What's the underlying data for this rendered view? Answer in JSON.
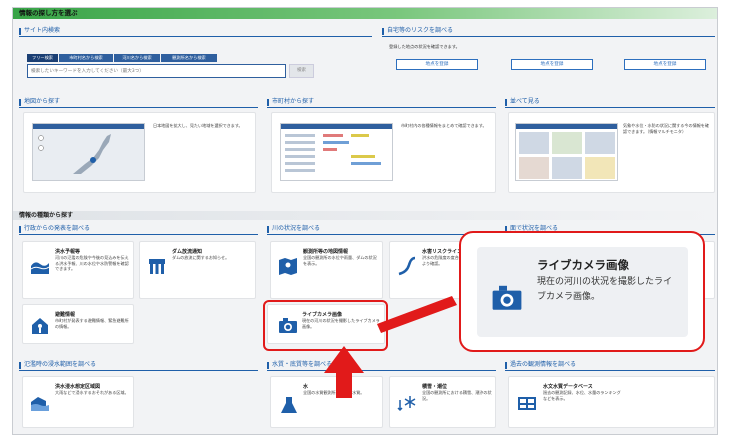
{
  "top_title": "情報の探し方を選ぶ",
  "site_search": {
    "title": "サイト内検索",
    "tabs": [
      "フリー検索",
      "市町村名から検索",
      "河川名から検索",
      "観測所名から検索"
    ],
    "placeholder": "検索したいキーワードを入力してください（最大3つ）",
    "button": "検索"
  },
  "risk": {
    "title": "自宅等のリスクを調べる",
    "desc": "登録した地点の状況を確認できます。",
    "buttons": [
      "地点を登録",
      "地点を登録",
      "地点を登録"
    ]
  },
  "map_search": {
    "title": "地図から探す",
    "desc": "日本地図を拡大し、見たい地域を選択できます。"
  },
  "city_search": {
    "title": "市町村から探す",
    "desc": "市町村内の各種情報をまとめて確認できます。"
  },
  "compare": {
    "title": "並べて見る",
    "desc": "気象や水位・水防の状況に関する今の情報を確認できます。（情報マルチモニタ）"
  },
  "kind_title": "情報の種類から探す",
  "gov": {
    "title": "行政からの発表を調べる",
    "items": [
      {
        "name": "洪水予報等",
        "desc": "河川の氾濫の危険や今後の見込みを伝える洪水予報、川の水位や水防警報を確認できます。"
      },
      {
        "name": "ダム放流通知",
        "desc": "ダムの放流に関するお知らせ。"
      },
      {
        "name": "避難情報",
        "desc": "市町村が発表する避難情報、緊急避難所の情報。"
      }
    ]
  },
  "river": {
    "title": "川の状況を調べる",
    "items": [
      {
        "name": "観測所等の地図情報",
        "desc": "全国の観測所の水位や雨量、ダムの状況を表示。"
      },
      {
        "name": "水害リスクライン",
        "desc": "洪水の危険度の度合いを地図上で線により確認。"
      },
      {
        "name": "ライブカメラ画像",
        "desc": "現在の河川の状況を撮影したライブカメラ画像。"
      }
    ]
  },
  "area": {
    "title": "面で状況を調べる"
  },
  "flood": {
    "title": "氾濫時の浸水範囲を調べる",
    "items": [
      {
        "name": "洪水浸水想定区域図",
        "desc": "大雨などで浸水するおそれがある区域。"
      }
    ]
  },
  "quality": {
    "title": "水質・底質等を調べる",
    "items": [
      {
        "name": "水",
        "desc": "全国の水質観測所における水質。"
      },
      {
        "name": "積雪・潮位",
        "desc": "全国の観測所における積雪、潮汐の状況。"
      }
    ]
  },
  "past": {
    "title": "過去の観測情報を調べる",
    "items": [
      {
        "name": "水文水質データベース",
        "desc": "過去の観測記録、水位、水量のランキングなどを表示。"
      }
    ]
  },
  "callout": {
    "title": "ライブカメラ画像",
    "desc": "現在の河川の状況を撮影したライブカメラ画像。"
  },
  "colors": {
    "accent": "#1f5fa9",
    "highlight": "#e11a1a",
    "green": "#38a447"
  }
}
